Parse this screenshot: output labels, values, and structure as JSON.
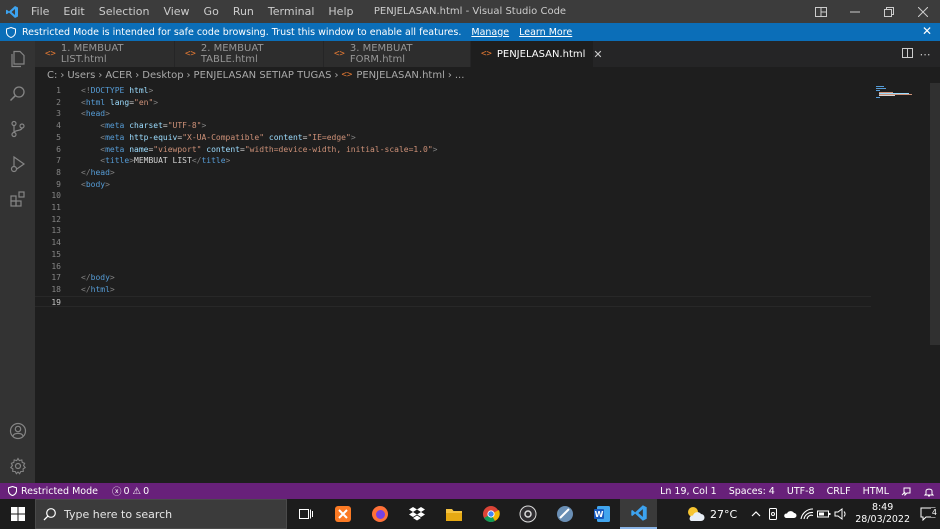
{
  "window": {
    "title": "PENJELASAN.html - Visual Studio Code",
    "menu": [
      "File",
      "Edit",
      "Selection",
      "View",
      "Go",
      "Run",
      "Terminal",
      "Help"
    ]
  },
  "banner": {
    "message": "Restricted Mode is intended for safe code browsing. Trust this window to enable all features.",
    "manage": "Manage",
    "learn_more": "Learn More"
  },
  "tabs": [
    {
      "label": "1. MEMBUAT LIST.html",
      "icon": "<>",
      "active": false
    },
    {
      "label": "2. MEMBUAT TABLE.html",
      "icon": "<>",
      "active": false
    },
    {
      "label": "3. MEMBUAT FORM.html",
      "icon": "<>",
      "active": false
    },
    {
      "label": "PENJELASAN.html",
      "icon": "<>",
      "active": true
    }
  ],
  "breadcrumb": [
    "C:",
    "Users",
    "ACER",
    "Desktop",
    "PENJELASAN SETIAP TUGAS",
    "PENJELASAN.html",
    "..."
  ],
  "editor": {
    "lines": [
      [
        [
          "br",
          "<!"
        ],
        [
          "tg",
          "DOCTYPE"
        ],
        [
          "tx",
          " "
        ],
        [
          "at",
          "html"
        ],
        [
          "br",
          ">"
        ]
      ],
      [
        [
          "br",
          "<"
        ],
        [
          "tg",
          "html"
        ],
        [
          "tx",
          " "
        ],
        [
          "at",
          "lang"
        ],
        [
          "tx",
          "="
        ],
        [
          "st",
          "\"en\""
        ],
        [
          "br",
          ">"
        ]
      ],
      [
        [
          "br",
          "<"
        ],
        [
          "tg",
          "head"
        ],
        [
          "br",
          ">"
        ]
      ],
      [
        [
          "tx",
          "    "
        ],
        [
          "br",
          "<"
        ],
        [
          "tg",
          "meta"
        ],
        [
          "tx",
          " "
        ],
        [
          "at",
          "charset"
        ],
        [
          "tx",
          "="
        ],
        [
          "st",
          "\"UTF-8\""
        ],
        [
          "br",
          ">"
        ]
      ],
      [
        [
          "tx",
          "    "
        ],
        [
          "br",
          "<"
        ],
        [
          "tg",
          "meta"
        ],
        [
          "tx",
          " "
        ],
        [
          "at",
          "http-equiv"
        ],
        [
          "tx",
          "="
        ],
        [
          "st",
          "\"X-UA-Compatible\""
        ],
        [
          "tx",
          " "
        ],
        [
          "at",
          "content"
        ],
        [
          "tx",
          "="
        ],
        [
          "st",
          "\"IE=edge\""
        ],
        [
          "br",
          ">"
        ]
      ],
      [
        [
          "tx",
          "    "
        ],
        [
          "br",
          "<"
        ],
        [
          "tg",
          "meta"
        ],
        [
          "tx",
          " "
        ],
        [
          "at",
          "name"
        ],
        [
          "tx",
          "="
        ],
        [
          "st",
          "\"viewport\""
        ],
        [
          "tx",
          " "
        ],
        [
          "at",
          "content"
        ],
        [
          "tx",
          "="
        ],
        [
          "st",
          "\"width=device-width, initial-scale=1.0\""
        ],
        [
          "br",
          ">"
        ]
      ],
      [
        [
          "tx",
          "    "
        ],
        [
          "br",
          "<"
        ],
        [
          "tg",
          "title"
        ],
        [
          "br",
          ">"
        ],
        [
          "tx",
          "MEMBUAT LIST"
        ],
        [
          "br",
          "</"
        ],
        [
          "tg",
          "title"
        ],
        [
          "br",
          ">"
        ]
      ],
      [
        [
          "br",
          "</"
        ],
        [
          "tg",
          "head"
        ],
        [
          "br",
          ">"
        ]
      ],
      [
        [
          "br",
          "<"
        ],
        [
          "tg",
          "body"
        ],
        [
          "br",
          ">"
        ]
      ],
      [],
      [],
      [],
      [],
      [],
      [],
      [],
      [
        [
          "br",
          "</"
        ],
        [
          "tg",
          "body"
        ],
        [
          "br",
          ">"
        ]
      ],
      [
        [
          "br",
          "</"
        ],
        [
          "tg",
          "html"
        ],
        [
          "br",
          ">"
        ]
      ],
      []
    ],
    "current_line": 19
  },
  "statusbar": {
    "restricted": "Restricted Mode",
    "errors": "0",
    "warnings": "0",
    "position": "Ln 19, Col 1",
    "spaces": "Spaces: 4",
    "encoding": "UTF-8",
    "eol": "CRLF",
    "language": "HTML"
  },
  "taskbar": {
    "search_placeholder": "Type here to search",
    "temperature": "27°C",
    "time": "8:49",
    "date": "28/03/2022",
    "notifications": "4"
  },
  "colors": {
    "accent_blue": "#0b6eb8",
    "statusbar_purple": "#68217a",
    "html_icon_orange": "#e37933"
  }
}
